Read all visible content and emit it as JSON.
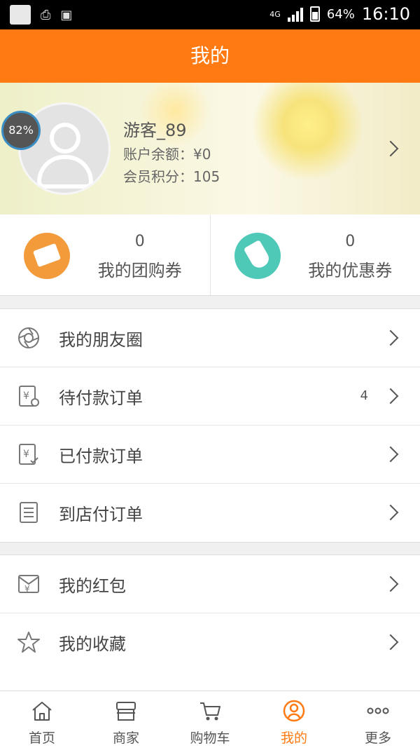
{
  "status_bar": {
    "network": "4G",
    "battery": "64%",
    "time": "16:10"
  },
  "header": {
    "title": "我的"
  },
  "profile": {
    "progress": "82%",
    "username": "游客_89",
    "balance": "账户余额：¥0",
    "points": "会员积分：105"
  },
  "vouchers": [
    {
      "count": "0",
      "label": "我的团购券",
      "icon": "group-coupon-icon",
      "color": "#f39a3a"
    },
    {
      "count": "0",
      "label": "我的优惠券",
      "icon": "discount-coupon-icon",
      "color": "#4ec9b8"
    }
  ],
  "orders_group": [
    {
      "label": "我的朋友圈",
      "icon": "camera-shutter-icon",
      "badge": ""
    },
    {
      "label": "待付款订单",
      "icon": "pending-payment-icon",
      "badge": "4"
    },
    {
      "label": "已付款订单",
      "icon": "paid-order-icon",
      "badge": ""
    },
    {
      "label": "到店付订单",
      "icon": "in-store-order-icon",
      "badge": ""
    }
  ],
  "wallet_group": [
    {
      "label": "我的红包",
      "icon": "red-envelope-icon",
      "badge": ""
    },
    {
      "label": "我的收藏",
      "icon": "star-icon",
      "badge": ""
    }
  ],
  "bottom_nav": [
    {
      "label": "首页",
      "icon": "home-icon",
      "active": false
    },
    {
      "label": "商家",
      "icon": "shop-icon",
      "active": false
    },
    {
      "label": "购物车",
      "icon": "cart-icon",
      "active": false
    },
    {
      "label": "我的",
      "icon": "profile-icon",
      "active": true
    },
    {
      "label": "更多",
      "icon": "more-icon",
      "active": false
    }
  ],
  "colors": {
    "accent": "#ff7a12",
    "text": "#444444"
  }
}
